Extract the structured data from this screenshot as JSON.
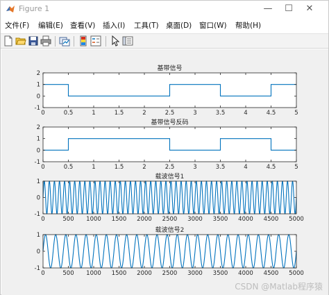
{
  "window": {
    "title": "Figure 1",
    "minimize_glyph": "—",
    "maximize_glyph": "☐",
    "close_glyph": "✕"
  },
  "menu": {
    "items": [
      {
        "label": "文件(F)"
      },
      {
        "label": "编辑(E)"
      },
      {
        "label": "查看(V)"
      },
      {
        "label": "插入(I)"
      },
      {
        "label": "工具(T)"
      },
      {
        "label": "桌面(D)"
      },
      {
        "label": "窗口(W)"
      },
      {
        "label": "帮助(H)"
      }
    ]
  },
  "toolbar": {
    "icons": [
      "new-figure-icon",
      "open-file-icon",
      "save-icon",
      "print-icon",
      "link-plot-icon",
      "insert-colorbar-icon",
      "insert-legend-icon",
      "select-arrow-icon",
      "property-inspector-icon"
    ]
  },
  "colors": {
    "line": "#0072bd",
    "axes_bg": "#ffffff",
    "figure_bg": "#f0f0f0",
    "axis_color": "#262626"
  },
  "watermark": "CSDN @Matlab程序猿",
  "chart_data": [
    {
      "type": "line",
      "title": "基带信号",
      "xlim": [
        0,
        5
      ],
      "ylim": [
        -1,
        2
      ],
      "x_ticks": [
        "0",
        "0.5",
        "1",
        "1.5",
        "2",
        "2.5",
        "3",
        "3.5",
        "4",
        "4.5",
        "5"
      ],
      "y_ticks": [
        "-1",
        "0",
        "1",
        "2"
      ],
      "series": [
        {
          "x": [
            0,
            0.5,
            0.5,
            2.5,
            2.5,
            3.5,
            3.5,
            4.5,
            4.5,
            5
          ],
          "y": [
            1,
            1,
            0,
            0,
            1,
            1,
            0,
            0,
            1,
            1
          ]
        }
      ]
    },
    {
      "type": "line",
      "title": "基带信号反码",
      "xlim": [
        0,
        5
      ],
      "ylim": [
        -1,
        2
      ],
      "x_ticks": [
        "0",
        "0.5",
        "1",
        "1.5",
        "2",
        "2.5",
        "3",
        "3.5",
        "4",
        "4.5",
        "5"
      ],
      "y_ticks": [
        "-1",
        "0",
        "1",
        "2"
      ],
      "series": [
        {
          "x": [
            0,
            0.5,
            0.5,
            2.5,
            2.5,
            3.5,
            3.5,
            4.5,
            4.5,
            5
          ],
          "y": [
            0,
            0,
            1,
            1,
            0,
            0,
            1,
            1,
            0,
            0
          ]
        }
      ]
    },
    {
      "type": "line",
      "title": "载波信号1",
      "xlim": [
        0,
        5000
      ],
      "ylim": [
        -1,
        1
      ],
      "x_ticks": [
        "0",
        "500",
        "1000",
        "1500",
        "2000",
        "2500",
        "3000",
        "3500",
        "4000",
        "4500",
        "5000"
      ],
      "y_ticks": [
        "-1",
        "0",
        "1"
      ],
      "waveform": "sine",
      "cycles": 50
    },
    {
      "type": "line",
      "title": "载波信号2",
      "xlim": [
        0,
        5000
      ],
      "ylim": [
        -1,
        1
      ],
      "x_ticks": [
        "0",
        "500",
        "1000",
        "1500",
        "2000",
        "2500",
        "3000",
        "3500",
        "4000",
        "4500",
        "5000"
      ],
      "y_ticks": [
        "-1",
        "0",
        "1"
      ],
      "waveform": "sine",
      "cycles": 25
    }
  ]
}
